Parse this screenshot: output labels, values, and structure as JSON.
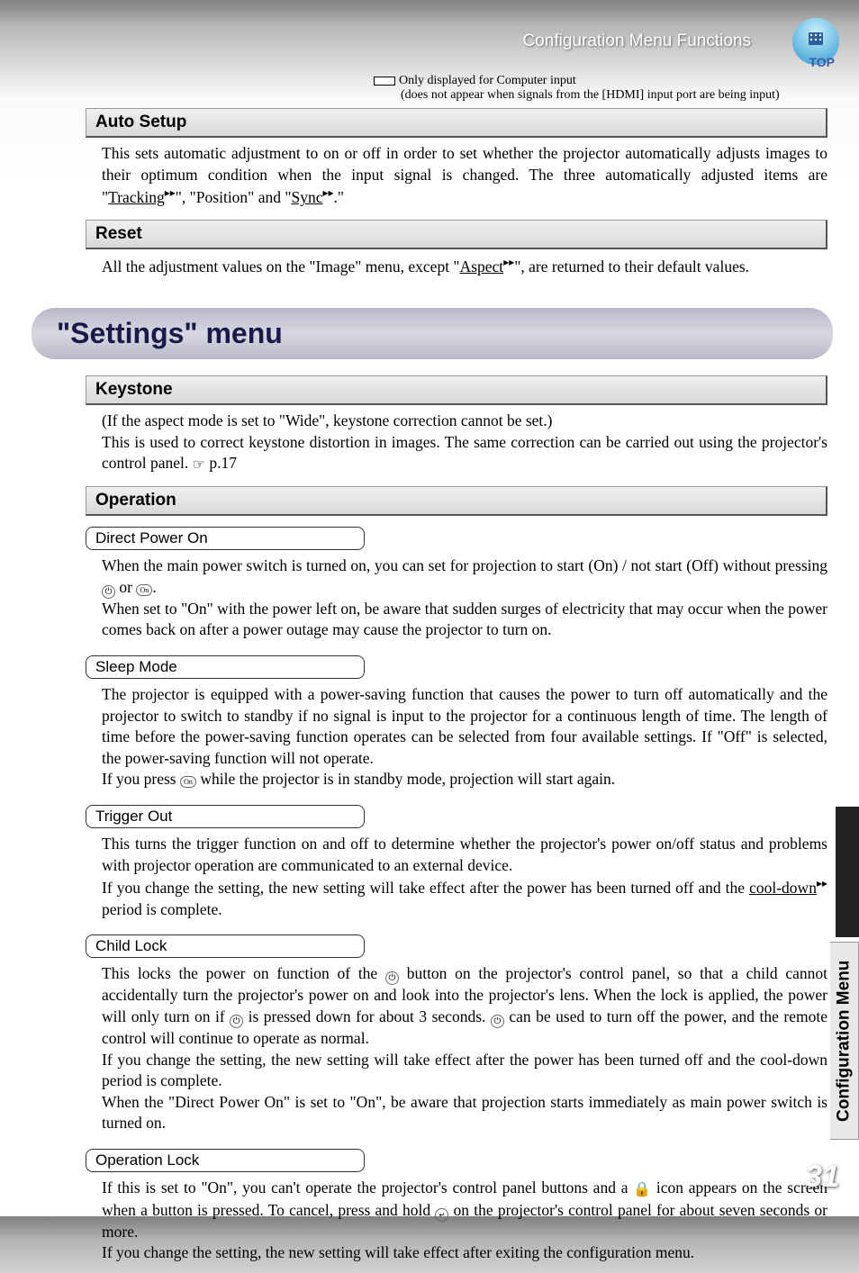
{
  "header": {
    "title": "Configuration Menu Functions",
    "top_label": "TOP"
  },
  "legend": {
    "text": "Only displayed for Computer input",
    "note": "(does not appear when signals from the [HDMI] input port are being input)"
  },
  "auto_setup": {
    "title": "Auto Setup",
    "body_pre": "This sets automatic adjustment to on or off in order to set whether the projector automatically adjusts images to their optimum condition when the input signal is changed. The three automatically adjusted items are \"",
    "tracking": "Tracking",
    "body_mid": "\", \"Position\" and \"",
    "sync": "Sync",
    "body_post": ".\""
  },
  "reset": {
    "title": "Reset",
    "body_pre": "All the adjustment values on the \"Image\" menu, except \"",
    "aspect": "Aspect",
    "body_post": "\", are returned to their default values."
  },
  "settings_menu": {
    "title": "\"Settings\" menu"
  },
  "keystone": {
    "title": "Keystone",
    "line1": "(If the aspect mode is set to \"Wide\", keystone correction cannot be set.)",
    "line2": "This is used to correct keystone distortion in images. The same correction can be carried out using the projector's control panel.",
    "ref": " p.17"
  },
  "operation": {
    "title": "Operation"
  },
  "direct_power": {
    "title": "Direct Power On",
    "p1a": "When the main power switch is turned on, you can set for projection to start (On) / not start (Off) without pressing ",
    "p1b": " or ",
    "p1c": ".",
    "p2": "When set to \"On\" with the power left on, be aware that sudden surges of electricity that may occur when the power comes back on after a power outage may cause the projector to turn on."
  },
  "sleep_mode": {
    "title": "Sleep Mode",
    "p1": "The projector is equipped with a power-saving function that causes the power to turn off automatically and the projector to switch to standby if no signal is input to the projector for a continuous length of time. The length of time before the power-saving function operates can be selected from four available settings. If \"Off\" is selected, the power-saving function will not operate.",
    "p2a": "If you press ",
    "p2b": " while the projector is in standby mode, projection will start again."
  },
  "trigger_out": {
    "title": "Trigger Out",
    "p1": "This turns the trigger function on and off to determine whether the projector's power on/off status and problems with projector operation are communicated to an external device.",
    "p2a": "If you change the setting, the new setting will take effect after the power has been turned off and the ",
    "cooldown": "cool-down",
    "p2b": " period is complete."
  },
  "child_lock": {
    "title": "Child Lock",
    "p1a": "This locks the power on function of the ",
    "p1b": " button on the projector's control panel, so that a child cannot accidentally turn the projector's power on and look into the projector's lens. When the lock is applied, the power will only turn on if ",
    "p1c": " is pressed down for about 3 seconds.  ",
    "p1d": " can be used to turn off the power, and the remote control will continue to operate as normal.",
    "p2": "If you change the setting, the new setting will take effect after the power has been turned off and the cool-down period is complete.",
    "p3": "When the \"Direct Power On\" is set to \"On\", be aware that projection starts immediately as main power switch is turned on."
  },
  "operation_lock": {
    "title": "Operation Lock",
    "p1a": "If this is set to \"On\", you can't operate the projector's control panel buttons and a ",
    "p1b": " icon appears on the screen when a button is pressed. To cancel, press and hold ",
    "p1c": " on the projector's control panel for about seven seconds or more.",
    "p2": "If you change the setting, the new setting will take effect after exiting the configuration menu."
  },
  "side_tab": "Configuration Menu",
  "page_number": "31"
}
